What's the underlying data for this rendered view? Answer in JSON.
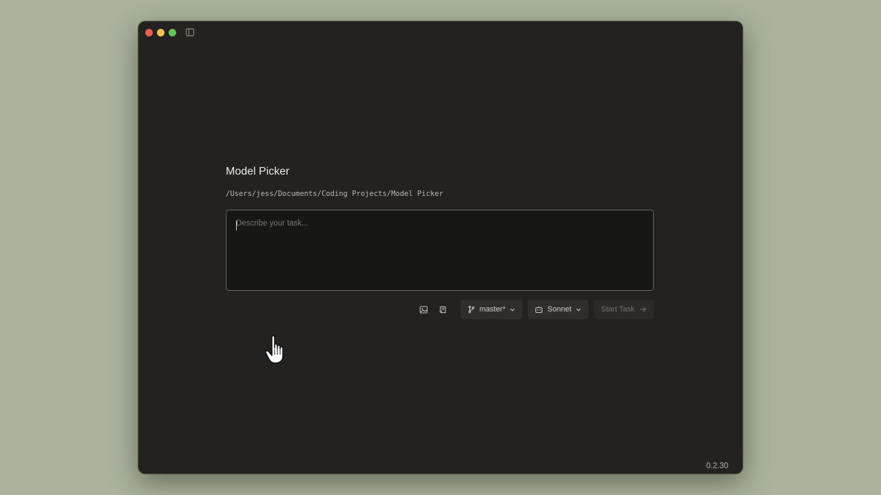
{
  "window": {
    "controls": [
      "close",
      "minimize",
      "maximize"
    ],
    "sidebar_toggle_icon": "sidebar-icon"
  },
  "project": {
    "title": "Model Picker",
    "path": "/Users/jess/Documents/Coding Projects/Model Picker"
  },
  "task_input": {
    "placeholder": "Describe your task...",
    "value": ""
  },
  "toolbar": {
    "attach_image_icon": "image-icon",
    "attach_file_icon": "scroll-icon",
    "branch_label": "master*",
    "model_label": "Sonnet",
    "start_label": "Start Task"
  },
  "footer": {
    "version": "0.2.30"
  },
  "colors": {
    "window_bg": "#232220",
    "desktop_bg": "#a9b39d",
    "input_bg": "#171716"
  }
}
